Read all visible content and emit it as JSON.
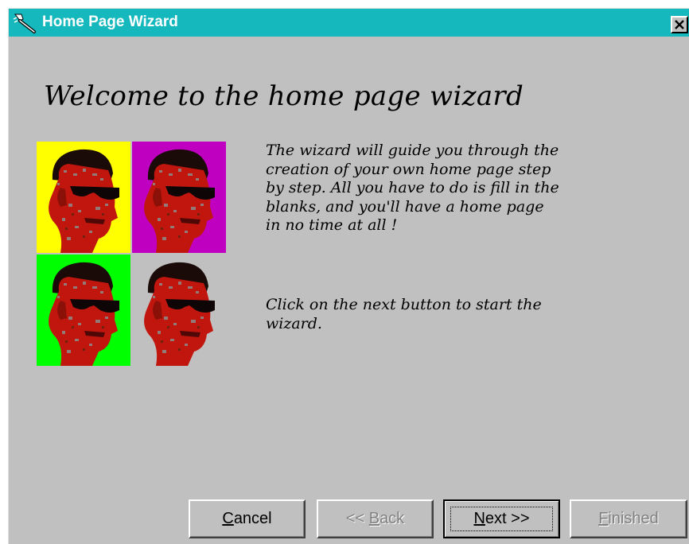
{
  "window": {
    "title": "Home Page Wizard",
    "title_bar_color": "#14b8bd",
    "background_color": "#c0c0c0",
    "title_icon": "wand-icon",
    "close_icon": "close-icon"
  },
  "content": {
    "heading": "Welcome to the home page wizard",
    "paragraph1_lines": [
      "The wizard will guide you through the",
      "creation of your own home page step",
      "by step. All you have to do is fill in the",
      "blanks, and you'll have a home page",
      "in no time at all !"
    ],
    "paragraph2_lines": [
      "Click on the next button to start the",
      "wizard."
    ],
    "portrait_tiles": [
      {
        "background": "#ffff00",
        "icon": "face-with-sunglasses-icon"
      },
      {
        "background": "#c000c0",
        "icon": "face-with-sunglasses-icon"
      },
      {
        "background": "#00ff00",
        "icon": "face-with-sunglasses-icon"
      },
      {
        "background": "#c0c0c0",
        "icon": "face-with-sunglasses-icon"
      }
    ]
  },
  "buttons": {
    "cancel": {
      "label_prefix": "",
      "label_mnemonic": "C",
      "label_rest": "ancel",
      "enabled": true
    },
    "back": {
      "label_prefix": "<< ",
      "label_mnemonic": "B",
      "label_rest": "ack",
      "enabled": false
    },
    "next": {
      "label_prefix": "",
      "label_mnemonic": "N",
      "label_rest": "ext >>",
      "enabled": true
    },
    "finished": {
      "label_prefix": "",
      "label_mnemonic": "F",
      "label_rest": "inished",
      "enabled": false
    }
  }
}
